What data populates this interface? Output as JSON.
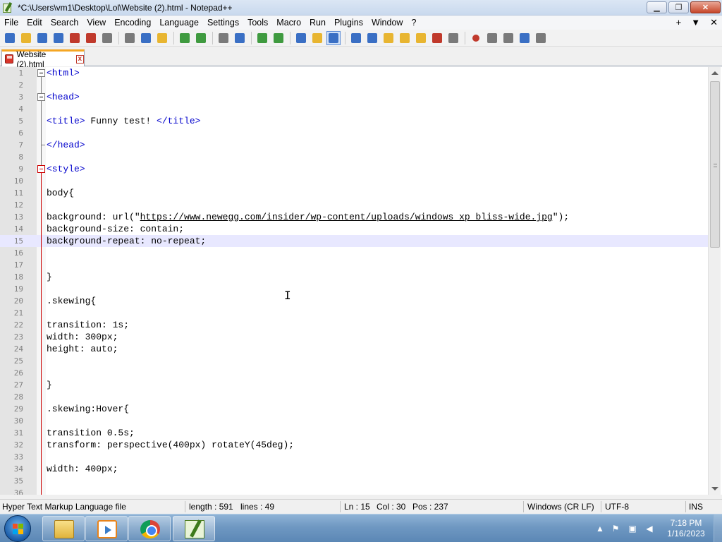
{
  "window": {
    "title": "*C:\\Users\\vm1\\Desktop\\Lol\\Website (2).html - Notepad++",
    "minimize_glyph": "▁",
    "restore_glyph": "❐",
    "close_glyph": "✕"
  },
  "menu": {
    "items": [
      "File",
      "Edit",
      "Search",
      "View",
      "Encoding",
      "Language",
      "Settings",
      "Tools",
      "Macro",
      "Run",
      "Plugins",
      "Window",
      "?"
    ],
    "right": [
      "+",
      "▼",
      "✕"
    ]
  },
  "toolbar": {
    "icons": [
      "new-file-icon",
      "open-file-icon",
      "save-icon",
      "save-all-icon",
      "close-icon",
      "close-all-icon",
      "print-icon",
      "cut-icon",
      "copy-icon",
      "paste-icon",
      "undo-icon",
      "redo-icon",
      "find-icon",
      "replace-icon",
      "zoom-in-icon",
      "zoom-out-icon",
      "sync-vertical-icon",
      "sync-horizontal-icon",
      "word-wrap-icon",
      "show-all-chars-icon",
      "indent-guide-icon",
      "user-defined-language-icon",
      "document-map-icon",
      "function-list-icon",
      "folder-as-workspace-icon",
      "monitoring-icon",
      "record-macro-icon",
      "stop-macro-icon",
      "play-macro-icon",
      "run-macro-multiple-icon",
      "save-macro-icon"
    ],
    "colors": {
      "blue": "#3a6fc4",
      "green": "#3f9a3f",
      "red": "#c0392b",
      "yellow": "#e8b530",
      "gray": "#7a7a7a"
    }
  },
  "tab": {
    "label": "Website (2).html",
    "close_glyph": "x"
  },
  "editor": {
    "current_line": 15,
    "lines": [
      {
        "n": "1",
        "text": "<html>",
        "kind": "tag"
      },
      {
        "n": "2",
        "text": "",
        "kind": "plain"
      },
      {
        "n": "3",
        "text": "<head>",
        "kind": "tag"
      },
      {
        "n": "4",
        "text": "",
        "kind": "plain"
      },
      {
        "n": "5",
        "text": "<title> Funny test! </title>",
        "kind": "title"
      },
      {
        "n": "6",
        "text": "",
        "kind": "plain"
      },
      {
        "n": "7",
        "text": "</head>",
        "kind": "tag"
      },
      {
        "n": "8",
        "text": "",
        "kind": "plain"
      },
      {
        "n": "9",
        "text": "<style>",
        "kind": "tag"
      },
      {
        "n": "10",
        "text": "",
        "kind": "plain"
      },
      {
        "n": "11",
        "text": "body{",
        "kind": "plain"
      },
      {
        "n": "12",
        "text": "",
        "kind": "plain"
      },
      {
        "n": "13",
        "text": "background: url(\"https://www.newegg.com/insider/wp-content/uploads/windows_xp_bliss-wide.jpg\");",
        "kind": "url"
      },
      {
        "n": "14",
        "text": "background-size: contain;",
        "kind": "plain"
      },
      {
        "n": "15",
        "text": "background-repeat: no-repeat;",
        "kind": "plain"
      },
      {
        "n": "16",
        "text": "",
        "kind": "plain"
      },
      {
        "n": "17",
        "text": "",
        "kind": "plain"
      },
      {
        "n": "18",
        "text": "}",
        "kind": "plain"
      },
      {
        "n": "19",
        "text": "",
        "kind": "plain"
      },
      {
        "n": "20",
        "text": ".skewing{",
        "kind": "plain"
      },
      {
        "n": "21",
        "text": "",
        "kind": "plain"
      },
      {
        "n": "22",
        "text": "transition: 1s;",
        "kind": "plain"
      },
      {
        "n": "23",
        "text": "width: 300px;",
        "kind": "plain"
      },
      {
        "n": "24",
        "text": "height: auto;",
        "kind": "plain"
      },
      {
        "n": "25",
        "text": "",
        "kind": "plain"
      },
      {
        "n": "26",
        "text": "",
        "kind": "plain"
      },
      {
        "n": "27",
        "text": "}",
        "kind": "plain"
      },
      {
        "n": "28",
        "text": "",
        "kind": "plain"
      },
      {
        "n": "29",
        "text": ".skewing:Hover{",
        "kind": "plain"
      },
      {
        "n": "30",
        "text": "",
        "kind": "plain"
      },
      {
        "n": "31",
        "text": "transition 0.5s;",
        "kind": "plain"
      },
      {
        "n": "32",
        "text": "transform: perspective(400px) rotateY(45deg);",
        "kind": "plain"
      },
      {
        "n": "33",
        "text": "",
        "kind": "plain"
      },
      {
        "n": "34",
        "text": "width: 400px;",
        "kind": "plain"
      },
      {
        "n": "35",
        "text": "",
        "kind": "plain"
      },
      {
        "n": "36",
        "text": "",
        "kind": "plain"
      }
    ],
    "url_prefix": "background: url(\"",
    "url_text": "https://www.newegg.com/insider/wp-content/uploads/windows_xp_bliss-wide.jpg",
    "url_suffix": "\");",
    "title_open": "<title>",
    "title_text": " Funny test! ",
    "title_close": "</title>",
    "text_cursor_glyph": "I"
  },
  "status": {
    "file_type": "Hyper Text Markup Language file",
    "length": "length : 591",
    "lines": "lines : 49",
    "ln": "Ln : 15",
    "col": "Col : 30",
    "pos": "Pos : 237",
    "eol": "Windows (CR LF)",
    "encoding": "UTF-8",
    "mode": "INS"
  },
  "taskbar": {
    "apps": [
      "windows-explorer",
      "windows-media-player",
      "google-chrome",
      "notepad-plus-plus"
    ],
    "tray_icons": [
      "show-hidden-icons",
      "action-center-icon",
      "network-icon",
      "volume-icon"
    ],
    "time": "7:18 PM",
    "date": "1/16/2023"
  }
}
